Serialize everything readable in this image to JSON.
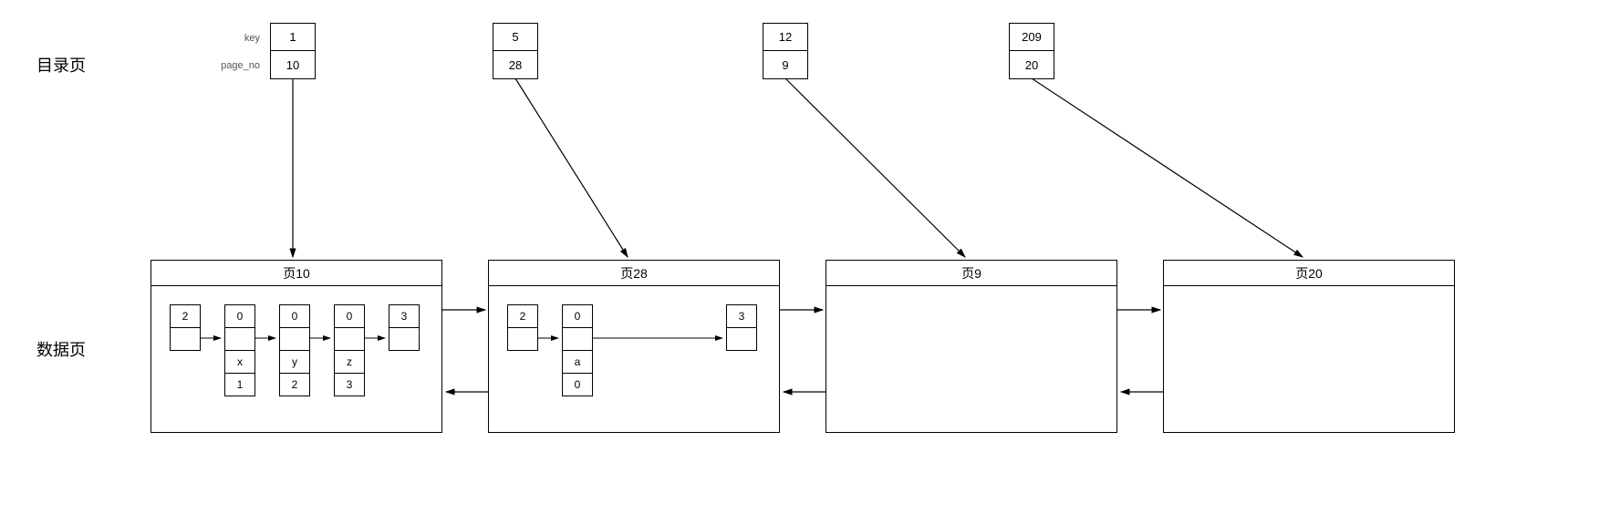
{
  "labels": {
    "directory_row": "目录页",
    "data_row": "数据页",
    "key_label": "key",
    "page_no_label": "page_no"
  },
  "directory": [
    {
      "key": "1",
      "page_no": "10"
    },
    {
      "key": "5",
      "page_no": "28"
    },
    {
      "key": "12",
      "page_no": "9"
    },
    {
      "key": "209",
      "page_no": "20"
    }
  ],
  "data_pages": [
    {
      "title": "页10",
      "records": [
        {
          "cells": [
            "2",
            ""
          ]
        },
        {
          "cells": [
            "0",
            "",
            "x",
            "1"
          ]
        },
        {
          "cells": [
            "0",
            "",
            "y",
            "2"
          ]
        },
        {
          "cells": [
            "0",
            "",
            "z",
            "3"
          ]
        },
        {
          "cells": [
            "3",
            ""
          ]
        }
      ]
    },
    {
      "title": "页28",
      "records": [
        {
          "cells": [
            "2",
            ""
          ]
        },
        {
          "cells": [
            "0",
            "",
            "a",
            "0"
          ]
        },
        {
          "cells": [
            "3",
            ""
          ]
        }
      ]
    },
    {
      "title": "页9",
      "records": []
    },
    {
      "title": "页20",
      "records": []
    }
  ]
}
